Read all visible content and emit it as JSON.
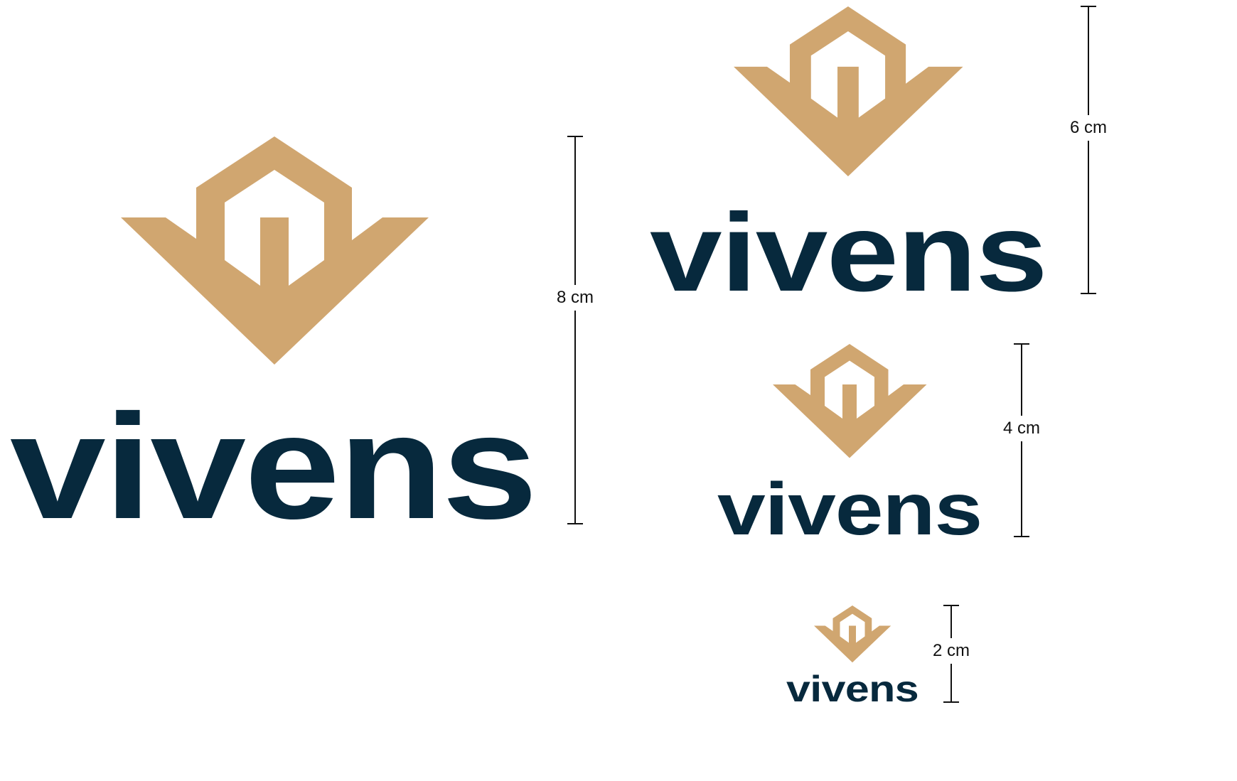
{
  "brand": {
    "wordmark": "vivens",
    "colors": {
      "emblem": "#d0a670",
      "wordmark": "#07293d",
      "dimension_lines": "#111111"
    },
    "emblem_icon": "house-in-chevron-icon"
  },
  "logos": [
    {
      "size_label": "8 cm"
    },
    {
      "size_label": "6 cm"
    },
    {
      "size_label": "4 cm"
    },
    {
      "size_label": "2 cm"
    }
  ]
}
